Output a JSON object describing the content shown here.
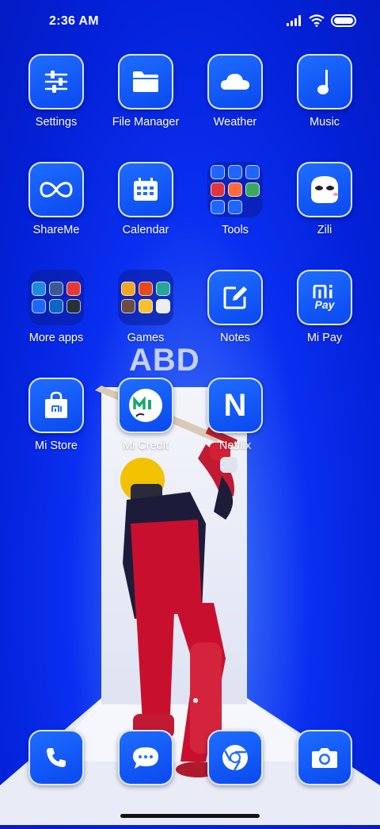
{
  "status": {
    "time": "2:36 AM"
  },
  "apps": {
    "settings": "Settings",
    "file_manager": "File Manager",
    "weather": "Weather",
    "music": "Music",
    "shareme": "ShareMe",
    "calendar": "Calendar",
    "tools": "Tools",
    "zili": "Zili",
    "more_apps": "More apps",
    "games": "Games",
    "notes": "Notes",
    "mi_pay": "Mi Pay",
    "mi_pay_icon_text": "Pay",
    "mi_store": "Mi Store",
    "mi_credit": "Mi Credit",
    "netflix": "Netflix",
    "netflix_icon_letter": "N"
  },
  "wallpaper": {
    "text": "ABD"
  },
  "dock": [
    "phone-icon",
    "messages-icon",
    "chrome-icon",
    "camera-icon"
  ],
  "colors": {
    "background": "#0a2ff0",
    "tile": "#1f6dff",
    "accent_red": "#d8213a"
  }
}
